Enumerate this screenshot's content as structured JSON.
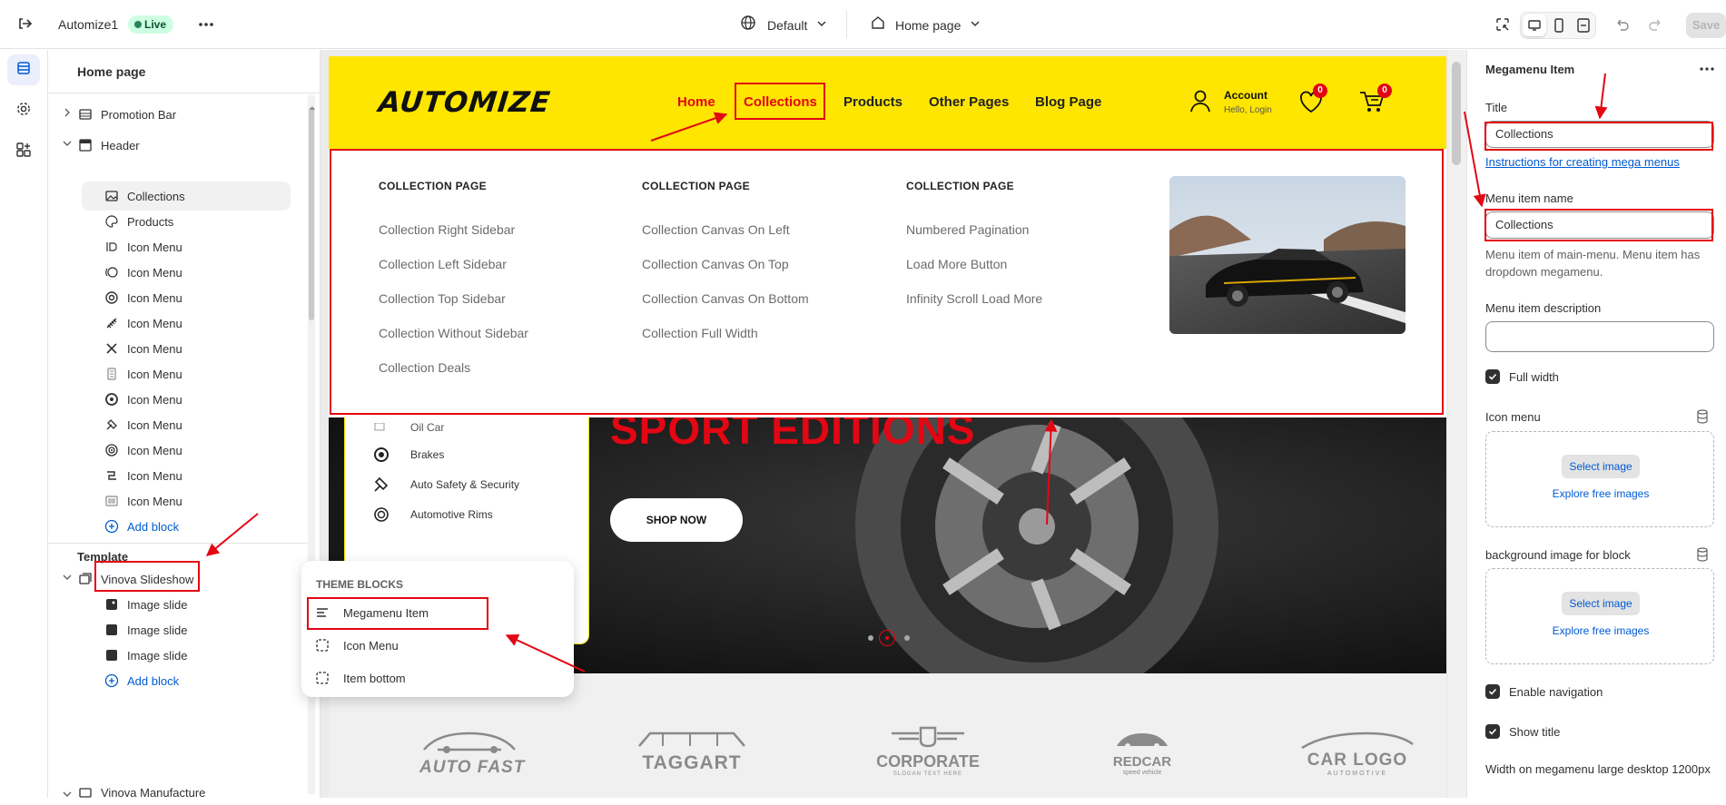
{
  "topbar": {
    "store_name": "Automize1",
    "status_badge": "Live",
    "theme_selector": "Default",
    "page_selector": "Home page",
    "save_label": "Save"
  },
  "sidebar": {
    "title": "Home page",
    "header_sections": [
      {
        "label": "Promotion Bar",
        "icon": "layout-icon"
      },
      {
        "label": "Header",
        "icon": "header-icon"
      }
    ],
    "header_blocks": [
      {
        "label": "Collections",
        "icon": "image-block-icon"
      },
      {
        "label": "Products",
        "icon": "palette-icon"
      },
      {
        "label": "Icon Menu",
        "icon": "engine-icon"
      },
      {
        "label": "Icon Menu",
        "icon": "brake-disc-icon"
      },
      {
        "label": "Icon Menu",
        "icon": "wheel-icon"
      },
      {
        "label": "Icon Menu",
        "icon": "spring-icon"
      },
      {
        "label": "Icon Menu",
        "icon": "tools-icon"
      },
      {
        "label": "Icon Menu",
        "icon": "oil-filter-icon"
      },
      {
        "label": "Icon Menu",
        "icon": "tire-icon"
      },
      {
        "label": "Icon Menu",
        "icon": "safety-icon"
      },
      {
        "label": "Icon Menu",
        "icon": "rim-icon"
      },
      {
        "label": "Icon Menu",
        "icon": "exhaust-icon"
      },
      {
        "label": "Icon Menu",
        "icon": "seat-icon"
      }
    ],
    "add_block_label": "Add block",
    "template_label": "Template",
    "template_sections": [
      {
        "label": "Vinova Slideshow"
      }
    ],
    "slideshow_blocks": [
      {
        "label": "Image slide"
      },
      {
        "label": "Image slide"
      },
      {
        "label": "Image slide"
      }
    ],
    "add_block_label_2": "Add block",
    "next_section": "Vinova Manufacture"
  },
  "popover": {
    "heading": "THEME BLOCKS",
    "items": [
      {
        "label": "Megamenu Item"
      },
      {
        "label": "Icon Menu"
      },
      {
        "label": "Item bottom"
      }
    ]
  },
  "site": {
    "logo": "AUTOMIZE",
    "nav": [
      "Home",
      "Collections",
      "Products",
      "Other Pages",
      "Blog Page"
    ],
    "account_label": "Account",
    "account_sub": "Hello, Login",
    "wishlist_count": "0",
    "cart_count": "0"
  },
  "megamenu": {
    "columns": [
      {
        "heading": "COLLECTION PAGE",
        "links": [
          "Collection Right Sidebar",
          "Collection Left Sidebar",
          "Collection Top Sidebar",
          "Collection Without Sidebar",
          "Collection Deals"
        ]
      },
      {
        "heading": "COLLECTION PAGE",
        "links": [
          "Collection Canvas On Left",
          "Collection Canvas On Top",
          "Collection Canvas On Bottom",
          "Collection Full Width"
        ]
      },
      {
        "heading": "COLLECTION PAGE",
        "links": [
          "Numbered Pagination",
          "Load More Button",
          "Infinity Scroll Load More"
        ]
      }
    ]
  },
  "hero": {
    "categories": [
      {
        "label": "Oil Car",
        "icon": "oil-icon"
      },
      {
        "label": "Brakes",
        "icon": "brake-icon"
      },
      {
        "label": "Auto Safety & Security",
        "icon": "safety-icon"
      },
      {
        "label": "Automotive Rims",
        "icon": "rim-icon"
      }
    ],
    "title": "SPORT EDITIONS",
    "cta": "SHOP NOW"
  },
  "brands": [
    {
      "name": "AUTO FAST"
    },
    {
      "name": "TAGGART"
    },
    {
      "name": "CORPORATE",
      "tagline": "SLOGAN TEXT HERE"
    },
    {
      "name": "REDCAR",
      "tagline": "speed vehicle"
    },
    {
      "name": "CAR LOGO",
      "tagline": "AUTOMOTIVE"
    }
  ],
  "settings": {
    "panel_title": "Megamenu Item",
    "title_label": "Title",
    "title_value": "Collections",
    "instructions_link": "Instructions for creating mega menus",
    "menu_item_name_label": "Menu item name",
    "menu_item_name_value": "Collections",
    "menu_item_help": "Menu item of main-menu. Menu item has dropdown megamenu.",
    "menu_item_desc_label": "Menu item description",
    "menu_item_desc_value": "",
    "full_width_label": "Full width",
    "icon_menu_label": "Icon menu",
    "select_image": "Select image",
    "explore_images": "Explore free images",
    "bg_image_label": "background image for block",
    "enable_navigation_label": "Enable navigation",
    "show_title_label": "Show title",
    "width_label": "Width on megamenu large desktop 1200px"
  },
  "colors": {
    "accent_yellow": "#ffe600",
    "accent_red": "#e30613",
    "link_blue": "#005bd3"
  }
}
